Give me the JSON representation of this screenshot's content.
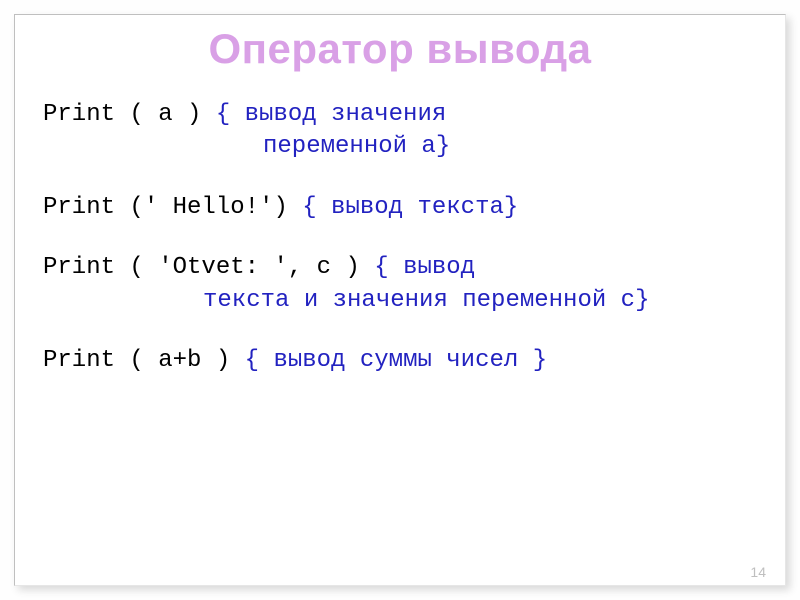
{
  "slide": {
    "title": "Оператор вывода",
    "lines": {
      "l1_code": "Print ( a )   ",
      "l1_comment_a": "{ вывод значения",
      "l1_comment_b": "переменной а}",
      "l2_code": "Print (' Hello!') ",
      "l2_comment": "{ вывод текста}",
      "l3_code": "Print ( 'Otvet: ', c )   ",
      "l3_comment_a": "{ вывод",
      "l3_comment_b": "текста и значения переменной с}",
      "l4_code": "Print ( a+b ) ",
      "l4_comment": "{ вывод суммы чисел }"
    },
    "page_number": "14"
  }
}
